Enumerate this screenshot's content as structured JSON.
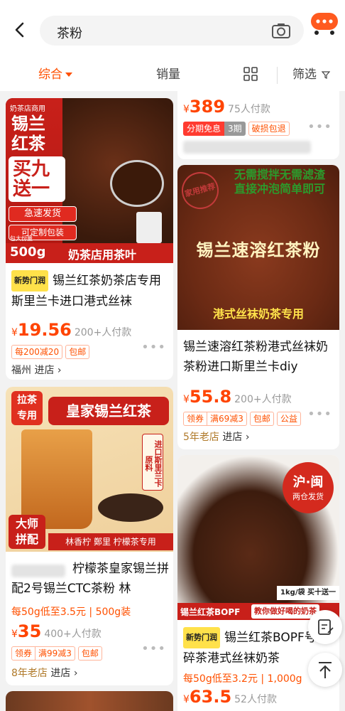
{
  "search": {
    "query": "茶粉"
  },
  "tabs": {
    "comprehensive": "综合",
    "sales": "销量",
    "filter": "筛选"
  },
  "cards": {
    "c1": {
      "img": {
        "corner": "奶茶店商用",
        "big1": "锡兰",
        "big2": "红茶",
        "promo1": "买九",
        "promo2": "送一",
        "ship": "急速发货",
        "custom": "可定制包装",
        "weight": "500g",
        "bottom": "奶茶店用茶叶",
        "pack": "包大份量"
      },
      "new_tag": "新势门润",
      "title": "锡兰红茶奶茶店专用斯里兰卡进口港式丝袜",
      "price_sym": "¥",
      "price": "19.56",
      "sales": "200+人付款",
      "badges": [
        "每200减20",
        "包邮"
      ],
      "shop": "福州 进店 ›"
    },
    "c2": {
      "price_sym": "¥",
      "price": "389",
      "sales": "75人付款",
      "badges": [
        "分期免息",
        "3期",
        "破损包退"
      ]
    },
    "c3": {
      "img": {
        "top1": "无需搅拌无需滤渣",
        "top2": "直接冲泡简单即可",
        "stamp": "家用推荐",
        "main": "锡兰速溶红茶粉",
        "bottom": "港式丝袜奶茶专用"
      },
      "title": "锡兰速溶红茶粉港式丝袜奶茶粉进口斯里兰卡diy",
      "price_sym": "¥",
      "price": "55.8",
      "sales": "200+人付款",
      "badges": [
        "领券",
        "满69减3",
        "包邮",
        "公益"
      ],
      "shop_gold": "5年老店",
      "shop": " 进店 ›"
    },
    "c4": {
      "img": {
        "tag1": "拉茶",
        "tag2": "专用",
        "banner": "皇家锡兰红茶",
        "side": "进口斯里兰卡原料",
        "master1": "大师",
        "master2": "拼配",
        "bottom": "林香柠 鄭里 柠檬茶专用"
      },
      "title": "柠檬茶皇家锡兰拼配2号锡兰CTC茶粉 林",
      "extra": "每50g低至3.5元 | 500g装",
      "price_sym": "¥",
      "price": "35",
      "sales": "400+人付款",
      "badges": [
        "领券",
        "满99减3",
        "包邮"
      ],
      "shop_gold": "8年老店",
      "shop": " 进店 ›"
    },
    "c5": {
      "img": {
        "badge1": "沪·闽",
        "badge2": "两仓发货",
        "pack": "1kg/袋 买十送一",
        "bottom1": "锡兰红茶BOPF",
        "bottom2": "教你做好喝的奶茶"
      },
      "new_tag": "新势门润",
      "title": "锡兰红茶BOPF号红碎茶港式丝袜奶茶",
      "extra": "每50g低至3.2元 | 1,000g",
      "price_sym": "¥",
      "price": "63.5",
      "sales": "52人付款"
    }
  },
  "colors": {
    "accent": "#ff5000",
    "price": "#ff4400"
  }
}
